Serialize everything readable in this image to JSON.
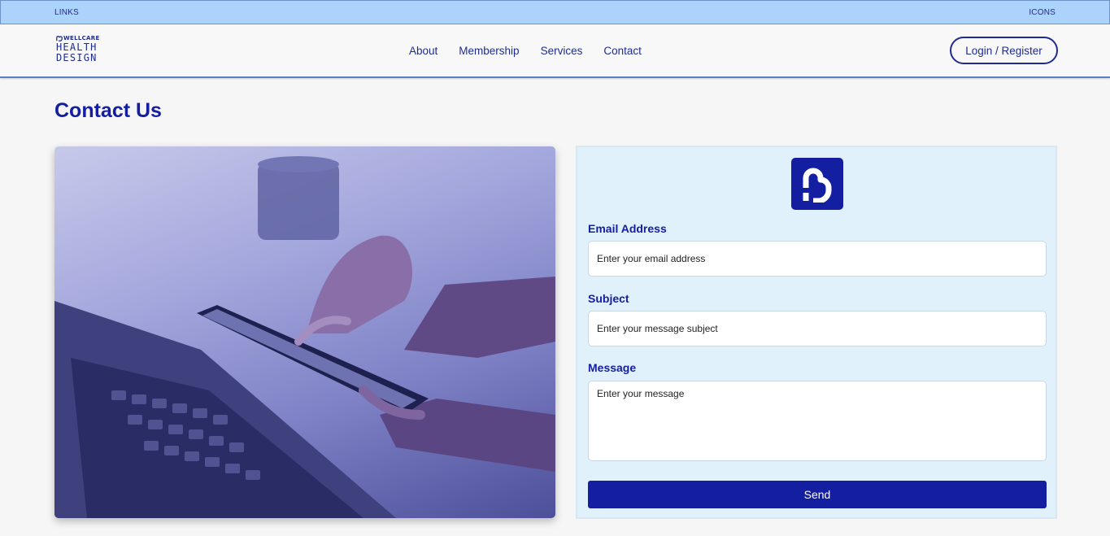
{
  "topbar": {
    "left_text": "LINKS",
    "right_text": "ICONS"
  },
  "logo": {
    "line1": "WELLCARE",
    "line2": "HEALTH",
    "line3": "DESIGN"
  },
  "nav": {
    "items": [
      "About",
      "Membership",
      "Services",
      "Contact"
    ]
  },
  "header": {
    "login_label": "Login / Register"
  },
  "page": {
    "title": "Contact Us"
  },
  "form": {
    "email_label": "Email Address",
    "email_placeholder": "Enter your email address",
    "subject_label": "Subject",
    "subject_placeholder": "Enter your message subject",
    "message_label": "Message",
    "message_placeholder": "Enter your message",
    "send_label": "Send"
  },
  "colors": {
    "brand": "#141ea0",
    "topbar": "#acd3fb",
    "form_bg": "#e1f1fb",
    "page_bg": "#f6f6f6"
  },
  "icons": {
    "logo_mark": "wellcare-mark-icon",
    "photo": "hands-phone-laptop-photo"
  }
}
